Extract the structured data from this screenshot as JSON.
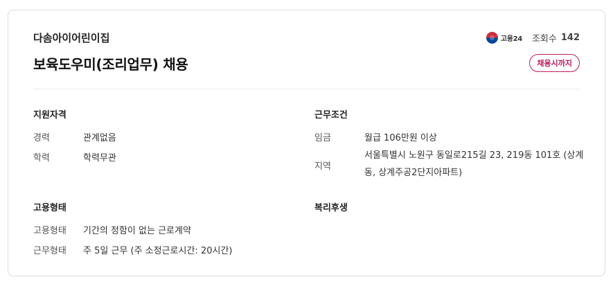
{
  "job": {
    "company": "다솜아이어린이집",
    "title": "보육도우미(조리업무) 채용",
    "source_logo_text": "고용24",
    "views_label": "조회수",
    "views_count": "142",
    "deadline_label": "채용시까지"
  },
  "qualifications": {
    "title": "지원자격",
    "rows": [
      {
        "key": "경력",
        "value": "관계없음"
      },
      {
        "key": "학력",
        "value": "학력무관"
      }
    ]
  },
  "conditions": {
    "title": "근무조건",
    "rows": [
      {
        "key": "임금",
        "value": "월급 106만원 이상"
      },
      {
        "key": "지역",
        "value": "서울특별시 노원구 동일로215길 23, 219동 101호 (상계동, 상계주공2단지아파트)"
      }
    ]
  },
  "employment": {
    "title": "고용형태",
    "rows": [
      {
        "key": "고용형태",
        "value": "기간의 정함이 없는 근로계약"
      },
      {
        "key": "근무형태",
        "value": "주 5일 근무 (주 소정근로시간: 20시간)"
      }
    ]
  },
  "benefits": {
    "title": "복리후생"
  },
  "colors": {
    "accent": "#c2185b",
    "border": "#dcdcdc"
  }
}
